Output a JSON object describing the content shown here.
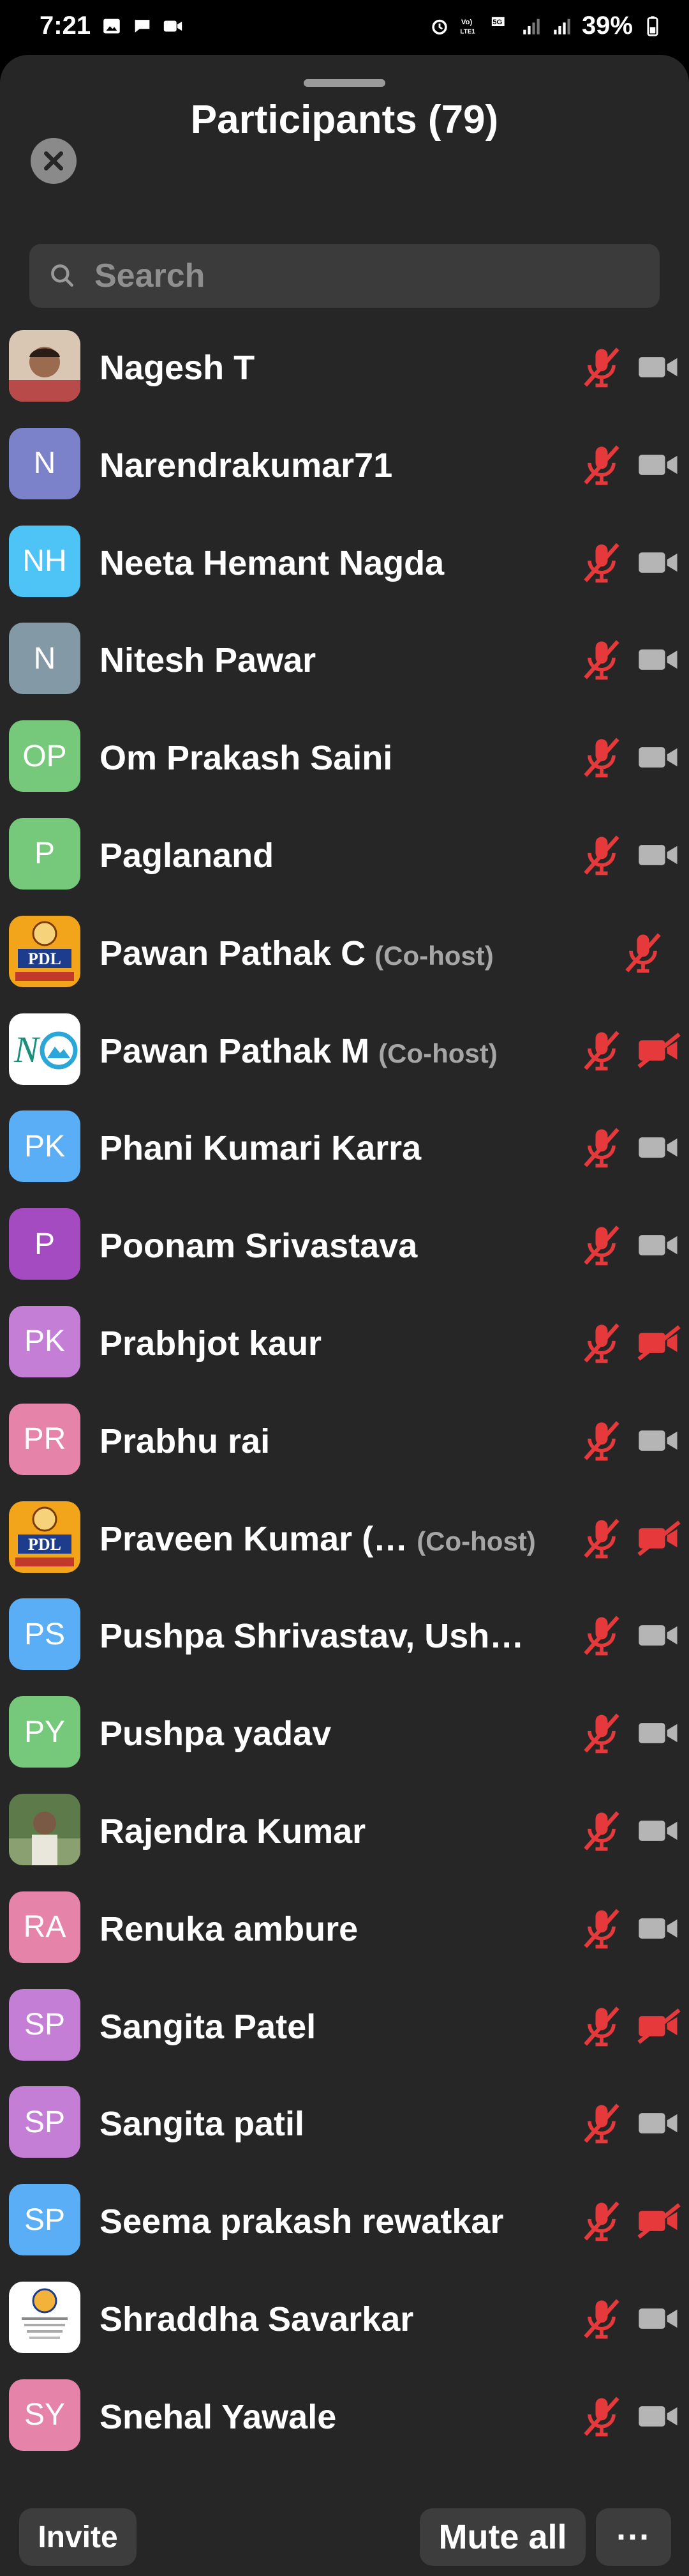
{
  "status_bar": {
    "time": "7:21",
    "battery": "39%"
  },
  "header": {
    "title": "Participants (79)"
  },
  "search": {
    "placeholder": "Search"
  },
  "participants": [
    {
      "name": "Nagesh T",
      "initials": "",
      "avatar": "photo-man",
      "mic": "muted",
      "cam": "off"
    },
    {
      "name": "Narendrakumar71",
      "initials": "N",
      "color": "#7b82c9",
      "mic": "muted",
      "cam": "off"
    },
    {
      "name": "Neeta Hemant Nagda",
      "initials": "NH",
      "color": "#4ec3f5",
      "mic": "muted",
      "cam": "off"
    },
    {
      "name": "Nitesh Pawar",
      "initials": "N",
      "color": "#8499a6",
      "mic": "muted",
      "cam": "off"
    },
    {
      "name": "Om Prakash Saini",
      "initials": "OP",
      "color": "#76c97b",
      "mic": "muted",
      "cam": "off"
    },
    {
      "name": "Paglanand",
      "initials": "P",
      "color": "#76c97b",
      "mic": "muted",
      "cam": "off"
    },
    {
      "name": "Pawan Pathak C",
      "cohost": "(Co-host)",
      "initials": "",
      "avatar": "pdl-logo",
      "mic": "muted",
      "cam": "none"
    },
    {
      "name": "Pawan Pathak M",
      "cohost": "(Co-host)",
      "initials": "",
      "avatar": "no-logo",
      "mic": "muted",
      "cam": "muted-red"
    },
    {
      "name": "Phani Kumari Karra",
      "initials": "PK",
      "color": "#5aaef5",
      "mic": "muted",
      "cam": "off"
    },
    {
      "name": "Poonam Srivastava",
      "initials": "P",
      "color": "#a54bc2",
      "mic": "muted",
      "cam": "off"
    },
    {
      "name": "Prabhjot kaur",
      "initials": "PK",
      "color": "#c47ed6",
      "mic": "muted",
      "cam": "muted-red"
    },
    {
      "name": "Prabhu rai",
      "initials": "PR",
      "color": "#e583a8",
      "mic": "muted",
      "cam": "off"
    },
    {
      "name": "Praveen Kumar (…",
      "cohost": "(Co-host)",
      "initials": "",
      "avatar": "pdl-logo",
      "mic": "muted",
      "cam": "muted-red"
    },
    {
      "name": "Pushpa Shrivastav, Ush…",
      "initials": "PS",
      "color": "#5aaef5",
      "mic": "muted",
      "cam": "off"
    },
    {
      "name": "Pushpa yadav",
      "initials": "PY",
      "color": "#76c97b",
      "mic": "muted",
      "cam": "off"
    },
    {
      "name": "Rajendra Kumar",
      "initials": "",
      "avatar": "photo-outdoor",
      "mic": "muted",
      "cam": "off"
    },
    {
      "name": "Renuka ambure",
      "initials": "RA",
      "color": "#e583a8",
      "mic": "muted",
      "cam": "off"
    },
    {
      "name": "Sangita Patel",
      "initials": "SP",
      "color": "#c47ed6",
      "mic": "muted",
      "cam": "muted-red"
    },
    {
      "name": "Sangita patil",
      "initials": "SP",
      "color": "#c47ed6",
      "mic": "muted",
      "cam": "off"
    },
    {
      "name": "Seema prakash rewatkar",
      "initials": "SP",
      "color": "#5aaef5",
      "mic": "muted",
      "cam": "muted-red"
    },
    {
      "name": "Shraddha Savarkar",
      "initials": "",
      "avatar": "seal-logo",
      "mic": "muted",
      "cam": "off"
    },
    {
      "name": "Snehal Yawale",
      "initials": "SY",
      "color": "#e583a8",
      "mic": "muted",
      "cam": "off"
    }
  ],
  "footer": {
    "invite_label": "Invite",
    "mute_all_label": "Mute all",
    "more_label": "···"
  },
  "colors": {
    "sheet": "#262626",
    "muted_red": "#e5393b",
    "cam_gray": "#b5b5b5",
    "cohost_gray": "#a6a6a6"
  }
}
